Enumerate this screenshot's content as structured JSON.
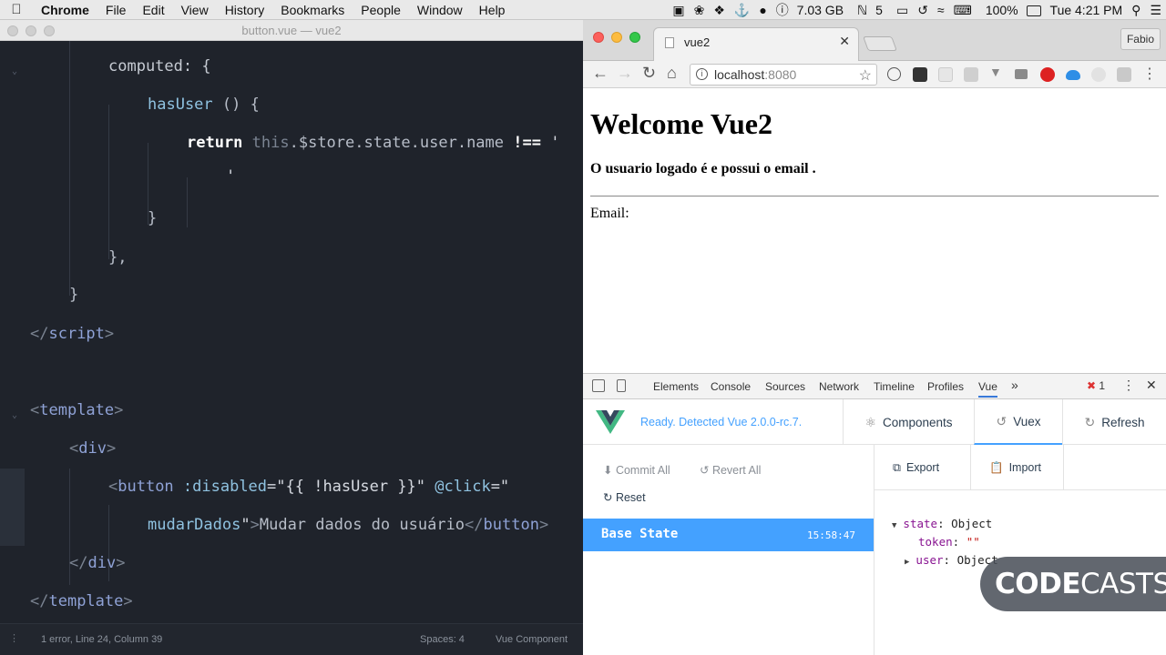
{
  "menubar": {
    "app": "Chrome",
    "items": [
      "File",
      "Edit",
      "View",
      "History",
      "Bookmarks",
      "People",
      "Window",
      "Help"
    ],
    "memory": "7.03 GB",
    "nu_count": "5",
    "battery": "100%",
    "clock": "Tue 4:21 PM"
  },
  "editor": {
    "window_title": "button.vue — vue2",
    "status": {
      "left": "1 error, Line 24, Column 39",
      "spaces": "Spaces: 4",
      "syntax": "Vue Component"
    },
    "code": {
      "l1": "computed: {",
      "l2_fn": "hasUser",
      "l2_rest": " () {",
      "l3_kw": "return",
      "l3_a": " this",
      "l3_b": ".$store.state.user.name ",
      "l3_op": "!==",
      "l3_q": " '",
      "l4": "'",
      "l5": "}",
      "l6": "},",
      "l7": "}",
      "l8_tag": "script",
      "l9_tag": "template",
      "l10_tag": "div",
      "l11_tag": "button",
      "l11_attr": " :disabled",
      "l11_val": "=\"{{ !hasUser }}\"",
      "l11_attr2": " @click",
      "l11_val2": "=\"",
      "l12_val": "mudarDados",
      "l12_q": "\"",
      "l12_text": "Mudar dados do usuário",
      "l13_tag": "div",
      "l14_tag": "template"
    }
  },
  "browser": {
    "tab_title": "vue2",
    "profile": "Fabio",
    "url_host": "localhost",
    "url_port": ":8080",
    "page": {
      "heading": "Welcome Vue2",
      "info": "O usuario logado é e possui o email .",
      "email_label": "Email:"
    }
  },
  "devtools": {
    "tabs": [
      "Elements",
      "Console",
      "Sources",
      "Network",
      "Timeline",
      "Profiles",
      "Vue"
    ],
    "active_tab": "Vue",
    "error_count": "1",
    "vue": {
      "ready_text": "Ready. Detected Vue 2.0.0-rc.7.",
      "nav": [
        "Components",
        "Vuex",
        "Refresh"
      ],
      "active_nav": "Vuex",
      "actions": {
        "commit_all": "Commit All",
        "revert_all": "Revert All",
        "reset": "Reset"
      },
      "base_state": {
        "name": "Base State",
        "time": "15:58:47"
      },
      "export_label": "Export",
      "import_label": "Import",
      "tree": {
        "state_key": "state",
        "state_type": ": Object",
        "token_key": "token",
        "token_val": "\"\"",
        "user_key": "user",
        "user_type": ": Object"
      }
    }
  },
  "watermark": {
    "bold": "CODE",
    "thin": "CASTS"
  },
  "colors": {
    "vue_accent": "#44a1ff",
    "editor_bg": "#1f232b"
  }
}
